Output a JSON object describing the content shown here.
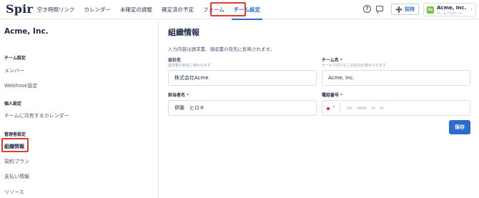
{
  "header": {
    "logo": "Spir",
    "nav": [
      "空き時間リンク",
      "カレンダー",
      "未確定の調整",
      "確定済の予定",
      "フォーム",
      "チーム設定"
    ],
    "active_nav": "チーム設定",
    "invite_label": "招待",
    "account": {
      "avatar": "Ac",
      "name": "Acme, Inc.",
      "subtitle": "チームアカウント"
    }
  },
  "sidebar": {
    "org_name": "Acme, Inc.",
    "sections": [
      {
        "title": "チーム設定",
        "items": [
          "メンバー",
          "Webhook設定"
        ]
      },
      {
        "title": "個人設定",
        "items": [
          "チームに共有するカレンダー"
        ]
      },
      {
        "title": "管理者設定",
        "items": [
          "組織情報",
          "契約プラン",
          "支払い情報",
          "リソース"
        ]
      }
    ],
    "active_item": "組織情報"
  },
  "main": {
    "title": "組織情報",
    "description": "入力内容は請求書、領収書の宛先に反映されます。",
    "company_name": {
      "label": "会社名",
      "hint": "請求書の宛名に使われます",
      "value": "株式会社Acme"
    },
    "team_name": {
      "label": "チーム名",
      "required_mark": "*",
      "hint": "サービス内でもこの名前が表示されます",
      "value": "Acme, Inc."
    },
    "contact_name": {
      "label": "担当者名",
      "required_mark": "*",
      "value": "伊藤　ヒロキ"
    },
    "phone": {
      "label": "電話番号",
      "required_mark": "*"
    },
    "save_label": "保存"
  },
  "colors": {
    "accent": "#2d6bd3",
    "highlight": "#e53935",
    "avatar": "#7bc142"
  },
  "icons": [
    "help-circle-icon",
    "chat-icon",
    "add-user-icon",
    "chevron-right-icon",
    "japan-flag-icon",
    "chevron-down-icon"
  ]
}
